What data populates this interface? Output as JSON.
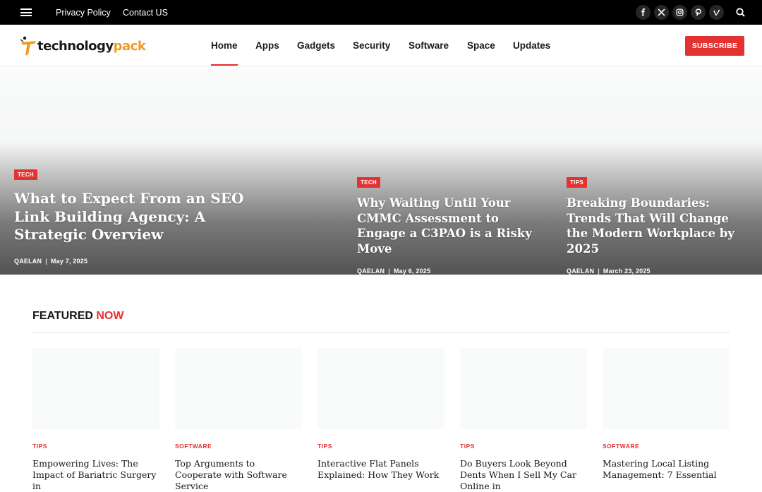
{
  "topbar": {
    "links": [
      "Privacy Policy",
      "Contact US"
    ],
    "social_icons": [
      "facebook-icon",
      "x-icon",
      "instagram-icon",
      "pinterest-icon",
      "vimeo-icon"
    ]
  },
  "header": {
    "logo": {
      "part1": "technology",
      "part2": "pack"
    },
    "nav": [
      "Home",
      "Apps",
      "Gadgets",
      "Security",
      "Software",
      "Space",
      "Updates"
    ],
    "active_nav": "Home",
    "subscribe_label": "SUBSCRIBE"
  },
  "hero": [
    {
      "category": "TECH",
      "title": "What to Expect From an SEO Link Building Agency: A Strategic Overview",
      "author": "QAELAN",
      "date": "May 7, 2025"
    },
    {
      "category": "TECH",
      "title": "Why Waiting Until Your CMMC Assessment to Engage a C3PAO is a Risky Move",
      "author": "QAELAN",
      "date": "May 6, 2025"
    },
    {
      "category": "TIPS",
      "title": "Breaking Boundaries: Trends That Will Change the Modern Workplace by 2025",
      "author": "QAELAN",
      "date": "March 23, 2025"
    }
  ],
  "featured": {
    "heading": "FEATURED",
    "heading_accent": "NOW",
    "cards": [
      {
        "category": "TIPS",
        "title": "Empowering Lives: The Impact of Bariatric Surgery in"
      },
      {
        "category": "SOFTWARE",
        "title": "Top Arguments to Cooperate with Software Service"
      },
      {
        "category": "TIPS",
        "title": "Interactive Flat Panels Explained: How They Work"
      },
      {
        "category": "TIPS",
        "title": "Do Buyers Look Beyond Dents When I Sell My Car Online in"
      },
      {
        "category": "SOFTWARE",
        "title": "Mastering Local Listing Management: 7 Essential"
      }
    ]
  },
  "colors": {
    "accent": "#e33232",
    "logo_orange": "#f29a24",
    "topbar": "#000000"
  }
}
